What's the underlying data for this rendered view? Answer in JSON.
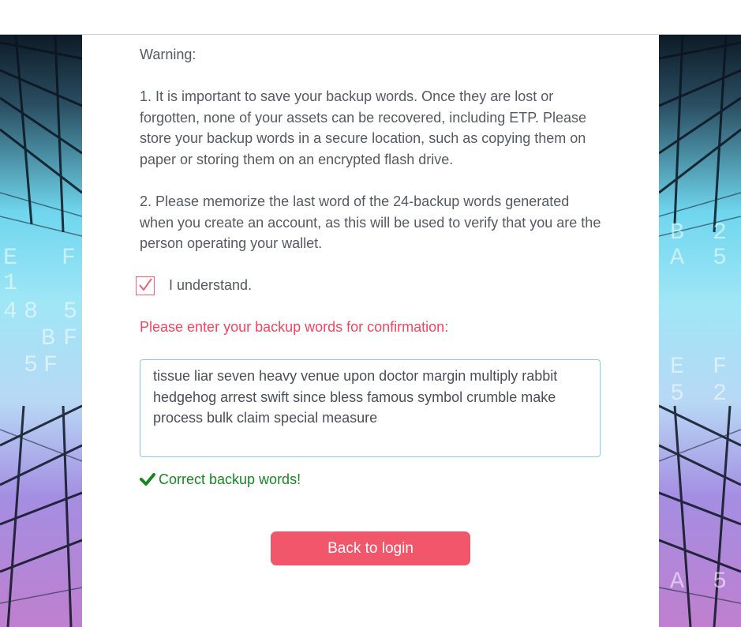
{
  "warning": {
    "title": "Warning:",
    "point1": "1. It is important to save your backup words. Once they are lost or forgotten, none of your assets can be recovered, including ETP. Please store your backup words in a secure location, such as copying them on paper or storing them on an encrypted flash drive.",
    "point2": "2. Please memorize the last word of the 24-backup words generated when you create an account, as this will be used to verify that you are the person operating your wallet."
  },
  "confirm": {
    "checkbox_label": "I understand.",
    "checked": true,
    "prompt": "Please enter your backup words for confirmation:",
    "backup_words": "tissue liar seven heavy venue upon doctor margin multiply rabbit hedgehog arrest swift since bless famous symbol crumble make process bulk claim special measure",
    "status_text": "Correct backup words!"
  },
  "actions": {
    "back_label": "Back to login"
  },
  "background": {
    "glyphs_left": [
      "E",
      "F",
      "1",
      "4",
      "8",
      "5",
      "B",
      "F",
      "5",
      "F"
    ],
    "glyphs_right": [
      "B",
      "2",
      "A",
      "5",
      "E",
      "F",
      "5",
      "2",
      "A",
      "5"
    ]
  },
  "colors": {
    "accent": "#f2566a",
    "prompt": "#f2455f",
    "success": "#16881f",
    "input_border": "#8ec6ec"
  }
}
